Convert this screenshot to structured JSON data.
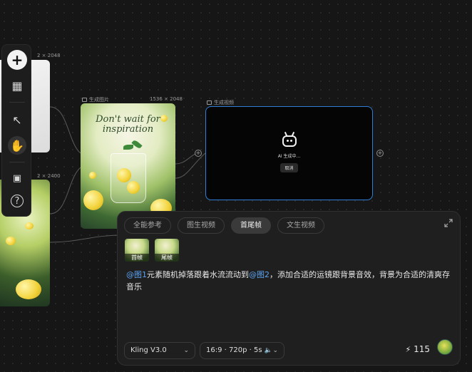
{
  "canvas": {
    "left_top_card_size": "2 × 2048",
    "left_bottom_card_size": "2 × 2400",
    "main_card": {
      "title": "生成图片",
      "size": "1536 × 2048",
      "poster_text": "Don't wait for inspiration"
    },
    "video_node": {
      "title": "生成视频",
      "status": "AI 生成中...",
      "cancel_label": "取消"
    }
  },
  "toolbar": {
    "add": "+",
    "grid": "▦",
    "select": "↖",
    "hand": "✋",
    "assets": "▣",
    "help": "?"
  },
  "prompt_panel": {
    "tabs": [
      {
        "label": "全能参考",
        "active": false
      },
      {
        "label": "图生视频",
        "active": false
      },
      {
        "label": "首尾帧",
        "active": true
      },
      {
        "label": "文生视频",
        "active": false
      }
    ],
    "thumbs": [
      {
        "label": "首帧"
      },
      {
        "label": "尾帧"
      }
    ],
    "prompt": {
      "mention1": "@图1",
      "part1": "元素随机掉落跟着水流流动到",
      "mention2": "@图2",
      "part2": "，添加合适的运镜跟背景音效，背景为合适的清爽存音乐"
    },
    "model": "Kling V3.0",
    "settings": "16:9 · 720p · 5s",
    "credits": "115"
  },
  "colors": {
    "accent": "#2f7fd9",
    "mention": "#5ba2f0",
    "background": "#161616"
  }
}
